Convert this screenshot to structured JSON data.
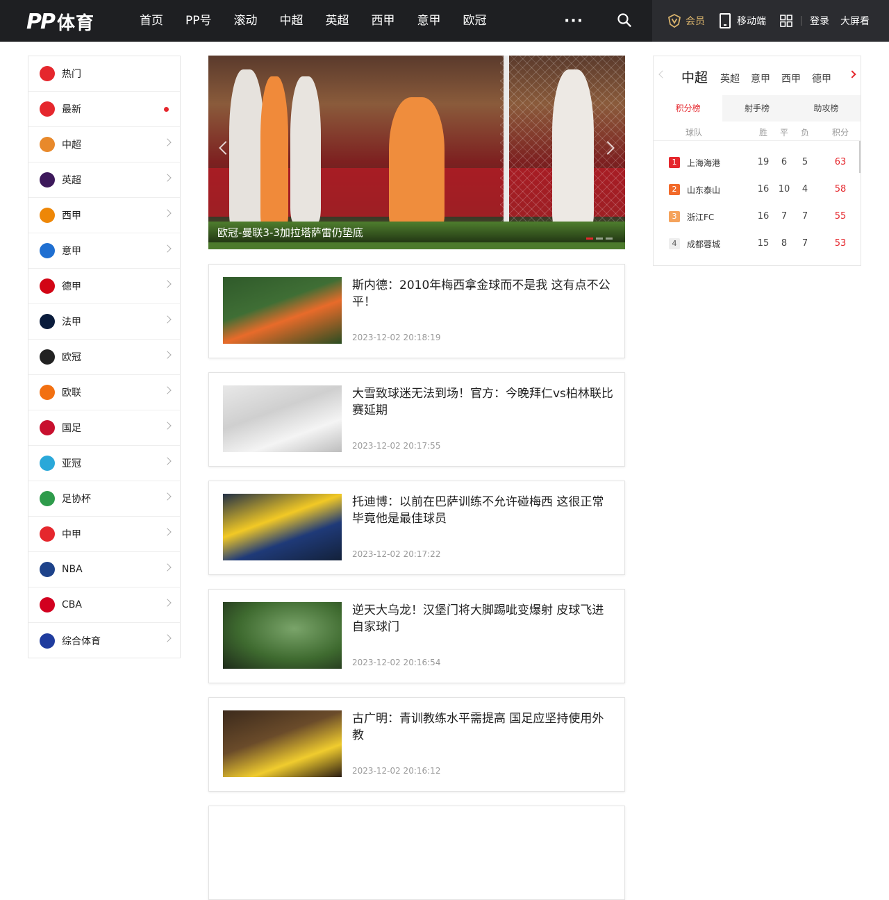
{
  "header": {
    "logo_pp": "PP",
    "logo_text": "体育",
    "nav": [
      "首页",
      "PP号",
      "滚动",
      "中超",
      "英超",
      "西甲",
      "意甲",
      "欧冠"
    ],
    "more": "···",
    "vip": "会员",
    "mobile": "移动端",
    "login": "登录",
    "bigscreen": "大屏看"
  },
  "sidebar": {
    "items": [
      {
        "label": "热门",
        "icon": "fire-icon",
        "color": "#e5272d"
      },
      {
        "label": "最新",
        "icon": "new-icon",
        "color": "#e5272d",
        "dot": true
      },
      {
        "label": "中超",
        "icon": "csl-icon",
        "color": "#e8892b"
      },
      {
        "label": "英超",
        "icon": "premier-league-icon",
        "color": "#3d195b"
      },
      {
        "label": "西甲",
        "icon": "laliga-icon",
        "color": "#ee8707"
      },
      {
        "label": "意甲",
        "icon": "serie-a-icon",
        "color": "#1f6fd1"
      },
      {
        "label": "德甲",
        "icon": "bundesliga-icon",
        "color": "#d20515"
      },
      {
        "label": "法甲",
        "icon": "ligue1-icon",
        "color": "#0a1c3c"
      },
      {
        "label": "欧冠",
        "icon": "ucl-icon",
        "color": "#222222"
      },
      {
        "label": "欧联",
        "icon": "uel-icon",
        "color": "#f27011"
      },
      {
        "label": "国足",
        "icon": "china-team-icon",
        "color": "#c8102e"
      },
      {
        "label": "亚冠",
        "icon": "afc-icon",
        "color": "#2aa8d9"
      },
      {
        "label": "足协杯",
        "icon": "fa-cup-icon",
        "color": "#2e9b4b"
      },
      {
        "label": "中甲",
        "icon": "china-league-one-icon",
        "color": "#e5272d"
      },
      {
        "label": "NBA",
        "icon": "nba-icon",
        "color": "#1d428a"
      },
      {
        "label": "CBA",
        "icon": "cba-icon",
        "color": "#d2001f"
      },
      {
        "label": "综合体育",
        "icon": "sports-icon",
        "color": "#1f3c9e"
      }
    ]
  },
  "hero": {
    "caption": "欧冠-曼联3-3加拉塔萨雷仍垫底"
  },
  "news": [
    {
      "title": "斯内德：2010年梅西拿金球而不是我 这有点不公平！",
      "time": "2023-12-02 20:18:19"
    },
    {
      "title": "大雪致球迷无法到场！官方：今晚拜仁vs柏林联比赛延期",
      "time": "2023-12-02 20:17:55"
    },
    {
      "title": "托迪博：以前在巴萨训练不允许碰梅西 这很正常毕竟他是最佳球员",
      "time": "2023-12-02 20:17:22"
    },
    {
      "title": "逆天大乌龙！汉堡门将大脚踢呲变爆射 皮球飞进自家球门",
      "time": "2023-12-02 20:16:54"
    },
    {
      "title": "古广明：青训教练水平需提高 国足应坚持使用外教",
      "time": "2023-12-02 20:16:12"
    }
  ],
  "standings": {
    "leagues": [
      "中超",
      "英超",
      "意甲",
      "西甲",
      "德甲"
    ],
    "tabs": [
      "积分榜",
      "射手榜",
      "助攻榜"
    ],
    "headers": {
      "team": "球队",
      "w": "胜",
      "d": "平",
      "l": "负",
      "pts": "积分"
    },
    "rows": [
      {
        "rank": "1",
        "team": "上海海港",
        "w": "19",
        "d": "6",
        "l": "5",
        "pts": "63",
        "color": "#e5272d"
      },
      {
        "rank": "2",
        "team": "山东泰山",
        "w": "16",
        "d": "10",
        "l": "4",
        "pts": "58",
        "color": "#f26a2a"
      },
      {
        "rank": "3",
        "team": "浙江FC",
        "w": "16",
        "d": "7",
        "l": "7",
        "pts": "55",
        "color": "#f5a35c"
      },
      {
        "rank": "4",
        "team": "成都蓉城",
        "w": "15",
        "d": "8",
        "l": "7",
        "pts": "53",
        "color": ""
      }
    ]
  },
  "colors": {
    "accent": "#e5272d",
    "topbar": "#1e1f22",
    "vip": "#d9b36c"
  }
}
